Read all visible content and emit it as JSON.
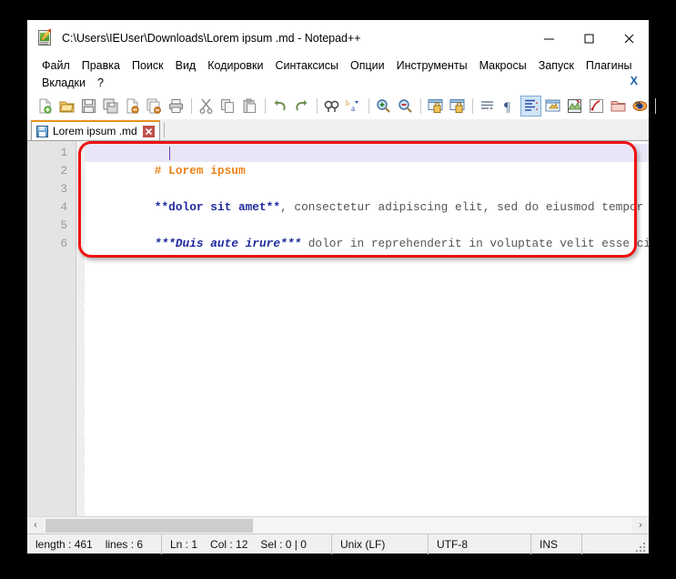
{
  "window": {
    "title": "C:\\Users\\IEUser\\Downloads\\Lorem ipsum .md - Notepad++",
    "app_icon": "notepad-pencil-icon",
    "controls": {
      "minimize": "minimize-icon",
      "maximize": "maximize-icon",
      "close": "close-icon"
    }
  },
  "menu": {
    "row1": [
      "Файл",
      "Правка",
      "Поиск",
      "Вид",
      "Кодировки",
      "Синтаксисы",
      "Опции",
      "Инструменты",
      "Макросы",
      "Запуск",
      "Плагины"
    ],
    "row2": [
      "Вкладки",
      "?"
    ],
    "close_document": "X"
  },
  "toolbar": {
    "overflow": "»",
    "buttons": [
      {
        "name": "new-file-icon",
        "active": false
      },
      {
        "name": "open-file-icon",
        "active": false
      },
      {
        "name": "save-icon",
        "active": false
      },
      {
        "name": "save-all-icon",
        "active": false
      },
      {
        "name": "close-file-icon",
        "active": false
      },
      {
        "name": "close-all-files-icon",
        "active": false
      },
      {
        "name": "print-icon",
        "active": false
      },
      {
        "name": "cut-icon",
        "active": false
      },
      {
        "name": "copy-icon",
        "active": false
      },
      {
        "name": "paste-icon",
        "active": false
      },
      {
        "name": "undo-icon",
        "active": false
      },
      {
        "name": "redo-icon",
        "active": false
      },
      {
        "name": "find-icon",
        "active": false
      },
      {
        "name": "replace-icon",
        "active": false
      },
      {
        "name": "zoom-in-icon",
        "active": false
      },
      {
        "name": "zoom-out-icon",
        "active": false
      },
      {
        "name": "sync-vertical-scroll-icon",
        "active": false
      },
      {
        "name": "sync-horizontal-scroll-icon",
        "active": false
      },
      {
        "name": "word-wrap-icon",
        "active": false
      },
      {
        "name": "show-pilcrow-icon",
        "active": false
      },
      {
        "name": "show-all-characters-icon",
        "active": true
      },
      {
        "name": "user-defined-dialog-icon",
        "active": false
      },
      {
        "name": "document-map-icon",
        "active": false
      },
      {
        "name": "function-list-icon",
        "active": false
      },
      {
        "name": "folder-as-workspace-icon",
        "active": false
      },
      {
        "name": "monitoring-icon",
        "active": false
      }
    ]
  },
  "tab": {
    "label": "Lorem ipsum .md",
    "save_state_icon": "saved-disk-icon",
    "close_icon": "tab-close-icon"
  },
  "editor": {
    "line_numbers": [
      "1",
      "2",
      "3",
      "4",
      "5",
      "6"
    ],
    "lines": [
      {
        "number": "1",
        "current": true,
        "segments": [
          {
            "text": "# Lorem ipsum",
            "style": "heading"
          }
        ]
      },
      {
        "number": "2",
        "current": false,
        "segments": []
      },
      {
        "number": "3",
        "current": false,
        "segments": [
          {
            "text": "**dolor sit amet**",
            "style": "bold"
          },
          {
            "text": ", consectetur adipiscing elit, sed do eiusmod tempor incid",
            "style": "plain"
          }
        ]
      },
      {
        "number": "4",
        "current": false,
        "segments": []
      },
      {
        "number": "5",
        "current": false,
        "segments": [
          {
            "text": "***Duis aute irure***",
            "style": "bold-italic"
          },
          {
            "text": " dolor in reprehenderit in voluptate velit esse cillum",
            "style": "plain"
          }
        ]
      },
      {
        "number": "6",
        "current": false,
        "segments": []
      }
    ],
    "colors": {
      "heading": "#e8821a",
      "bold": "#1f2a9c",
      "plain": "#555555",
      "current_line_bg": "#e8e6f6",
      "caret": "#6a3fb5",
      "annotation": "#ee1111"
    }
  },
  "scrollbar": {
    "left_arrow": "‹",
    "right_arrow": "›"
  },
  "status": {
    "length_label": "length : 461",
    "lines_label": "lines : 6",
    "ln": "Ln : 1",
    "col": "Col : 12",
    "sel": "Sel : 0 | 0",
    "eol": "Unix (LF)",
    "encoding": "UTF-8",
    "insert_mode": "INS"
  }
}
